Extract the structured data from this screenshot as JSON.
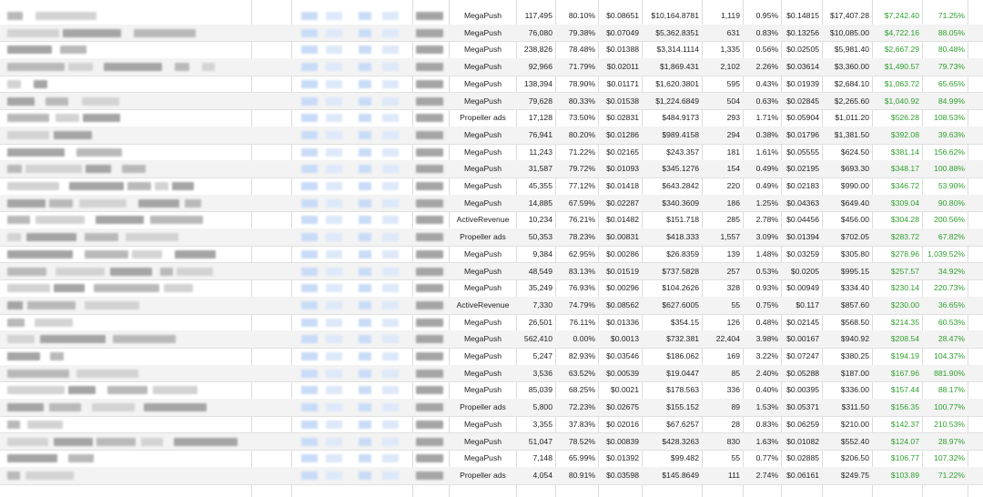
{
  "table": {
    "rows": [
      {
        "network": "MegaPush",
        "v1": "117,495",
        "p1": "80.10%",
        "cost": "$0.08651",
        "total": "$10,164.8781",
        "count": "1,119",
        "p2": "0.95%",
        "rate": "$0.14815",
        "rev": "$17,407.28",
        "profit": "$7,242.40",
        "roi": "71.25%"
      },
      {
        "network": "MegaPush",
        "v1": "76,080",
        "p1": "79.38%",
        "cost": "$0.07049",
        "total": "$5,362.8351",
        "count": "631",
        "p2": "0.83%",
        "rate": "$0.13256",
        "rev": "$10,085.00",
        "profit": "$4,722.16",
        "roi": "88.05%"
      },
      {
        "network": "MegaPush",
        "v1": "238,826",
        "p1": "78.48%",
        "cost": "$0.01388",
        "total": "$3,314.1114",
        "count": "1,335",
        "p2": "0.56%",
        "rate": "$0.02505",
        "rev": "$5,981.40",
        "profit": "$2,667.29",
        "roi": "80.48%"
      },
      {
        "network": "MegaPush",
        "v1": "92,966",
        "p1": "71.79%",
        "cost": "$0.02011",
        "total": "$1,869.431",
        "count": "2,102",
        "p2": "2.26%",
        "rate": "$0.03614",
        "rev": "$3,360.00",
        "profit": "$1,490.57",
        "roi": "79.73%"
      },
      {
        "network": "MegaPush",
        "v1": "138,394",
        "p1": "78.90%",
        "cost": "$0.01171",
        "total": "$1,620.3801",
        "count": "595",
        "p2": "0.43%",
        "rate": "$0.01939",
        "rev": "$2,684.10",
        "profit": "$1,063.72",
        "roi": "65.65%"
      },
      {
        "network": "MegaPush",
        "v1": "79,628",
        "p1": "80.33%",
        "cost": "$0.01538",
        "total": "$1,224.6849",
        "count": "504",
        "p2": "0.63%",
        "rate": "$0.02845",
        "rev": "$2,265.60",
        "profit": "$1,040.92",
        "roi": "84.99%"
      },
      {
        "network": "Propeller ads",
        "v1": "17,128",
        "p1": "73.50%",
        "cost": "$0.02831",
        "total": "$484.9173",
        "count": "293",
        "p2": "1.71%",
        "rate": "$0.05904",
        "rev": "$1,011.20",
        "profit": "$526.28",
        "roi": "108.53%"
      },
      {
        "network": "MegaPush",
        "v1": "76,941",
        "p1": "80.20%",
        "cost": "$0.01286",
        "total": "$989.4158",
        "count": "294",
        "p2": "0.38%",
        "rate": "$0.01796",
        "rev": "$1,381.50",
        "profit": "$392.08",
        "roi": "39.63%"
      },
      {
        "network": "MegaPush",
        "v1": "11,243",
        "p1": "71.22%",
        "cost": "$0.02165",
        "total": "$243.357",
        "count": "181",
        "p2": "1.61%",
        "rate": "$0.05555",
        "rev": "$624.50",
        "profit": "$381.14",
        "roi": "156.62%"
      },
      {
        "network": "MegaPush",
        "v1": "31,587",
        "p1": "79.72%",
        "cost": "$0.01093",
        "total": "$345.1276",
        "count": "154",
        "p2": "0.49%",
        "rate": "$0.02195",
        "rev": "$693.30",
        "profit": "$348.17",
        "roi": "100.88%"
      },
      {
        "network": "MegaPush",
        "v1": "45,355",
        "p1": "77.12%",
        "cost": "$0.01418",
        "total": "$643.2842",
        "count": "220",
        "p2": "0.49%",
        "rate": "$0.02183",
        "rev": "$990.00",
        "profit": "$346.72",
        "roi": "53.90%"
      },
      {
        "network": "MegaPush",
        "v1": "14,885",
        "p1": "67.59%",
        "cost": "$0.02287",
        "total": "$340.3609",
        "count": "186",
        "p2": "1.25%",
        "rate": "$0.04363",
        "rev": "$649.40",
        "profit": "$309.04",
        "roi": "90.80%"
      },
      {
        "network": "ActiveRevenue",
        "v1": "10,234",
        "p1": "76.21%",
        "cost": "$0.01482",
        "total": "$151.718",
        "count": "285",
        "p2": "2.78%",
        "rate": "$0.04456",
        "rev": "$456.00",
        "profit": "$304.28",
        "roi": "200.56%"
      },
      {
        "network": "Propeller ads",
        "v1": "50,353",
        "p1": "78.23%",
        "cost": "$0.00831",
        "total": "$418.333",
        "count": "1,557",
        "p2": "3.09%",
        "rate": "$0.01394",
        "rev": "$702.05",
        "profit": "$283.72",
        "roi": "67.82%"
      },
      {
        "network": "MegaPush",
        "v1": "9,384",
        "p1": "62.95%",
        "cost": "$0.00286",
        "total": "$26.8359",
        "count": "139",
        "p2": "1.48%",
        "rate": "$0.03259",
        "rev": "$305.80",
        "profit": "$278.96",
        "roi": "1,039.52%"
      },
      {
        "network": "MegaPush",
        "v1": "48,549",
        "p1": "83.13%",
        "cost": "$0.01519",
        "total": "$737.5828",
        "count": "257",
        "p2": "0.53%",
        "rate": "$0.0205",
        "rev": "$995.15",
        "profit": "$257.57",
        "roi": "34.92%"
      },
      {
        "network": "MegaPush",
        "v1": "35,249",
        "p1": "76.93%",
        "cost": "$0.00296",
        "total": "$104.2626",
        "count": "328",
        "p2": "0.93%",
        "rate": "$0.00949",
        "rev": "$334.40",
        "profit": "$230.14",
        "roi": "220.73%"
      },
      {
        "network": "ActiveRevenue",
        "v1": "7,330",
        "p1": "74.79%",
        "cost": "$0.08562",
        "total": "$627.6005",
        "count": "55",
        "p2": "0.75%",
        "rate": "$0.117",
        "rev": "$857.60",
        "profit": "$230.00",
        "roi": "36.65%"
      },
      {
        "network": "MegaPush",
        "v1": "26,501",
        "p1": "76.11%",
        "cost": "$0.01336",
        "total": "$354.15",
        "count": "126",
        "p2": "0.48%",
        "rate": "$0.02145",
        "rev": "$568.50",
        "profit": "$214.35",
        "roi": "60.53%"
      },
      {
        "network": "MegaPush",
        "v1": "562,410",
        "p1": "0.00%",
        "cost": "$0.0013",
        "total": "$732.381",
        "count": "22,404",
        "p2": "3.98%",
        "rate": "$0.00167",
        "rev": "$940.92",
        "profit": "$208.54",
        "roi": "28.47%"
      },
      {
        "network": "MegaPush",
        "v1": "5,247",
        "p1": "82.93%",
        "cost": "$0.03546",
        "total": "$186.062",
        "count": "169",
        "p2": "3.22%",
        "rate": "$0.07247",
        "rev": "$380.25",
        "profit": "$194.19",
        "roi": "104.37%"
      },
      {
        "network": "MegaPush",
        "v1": "3,536",
        "p1": "63.52%",
        "cost": "$0.00539",
        "total": "$19.0447",
        "count": "85",
        "p2": "2.40%",
        "rate": "$0.05288",
        "rev": "$187.00",
        "profit": "$167.96",
        "roi": "881.90%"
      },
      {
        "network": "MegaPush",
        "v1": "85,039",
        "p1": "68.25%",
        "cost": "$0.0021",
        "total": "$178.563",
        "count": "336",
        "p2": "0.40%",
        "rate": "$0.00395",
        "rev": "$336.00",
        "profit": "$157.44",
        "roi": "88.17%"
      },
      {
        "network": "Propeller ads",
        "v1": "5,800",
        "p1": "72.23%",
        "cost": "$0.02675",
        "total": "$155.152",
        "count": "89",
        "p2": "1.53%",
        "rate": "$0.05371",
        "rev": "$311.50",
        "profit": "$156.35",
        "roi": "100.77%"
      },
      {
        "network": "MegaPush",
        "v1": "3,355",
        "p1": "37.83%",
        "cost": "$0.02016",
        "total": "$67.6257",
        "count": "28",
        "p2": "0.83%",
        "rate": "$0.06259",
        "rev": "$210.00",
        "profit": "$142.37",
        "roi": "210.53%"
      },
      {
        "network": "MegaPush",
        "v1": "51,047",
        "p1": "78.52%",
        "cost": "$0.00839",
        "total": "$428.3263",
        "count": "830",
        "p2": "1.63%",
        "rate": "$0.01082",
        "rev": "$552.40",
        "profit": "$124.07",
        "roi": "28.97%"
      },
      {
        "network": "MegaPush",
        "v1": "7,148",
        "p1": "65.99%",
        "cost": "$0.01392",
        "total": "$99.482",
        "count": "55",
        "p2": "0.77%",
        "rate": "$0.02885",
        "rev": "$206.50",
        "profit": "$106.77",
        "roi": "107.32%"
      },
      {
        "network": "Propeller ads",
        "v1": "4,054",
        "p1": "80.91%",
        "cost": "$0.03598",
        "total": "$145.8649",
        "count": "111",
        "p2": "2.74%",
        "rate": "$0.06161",
        "rev": "$249.75",
        "profit": "$103.89",
        "roi": "71.22%"
      }
    ]
  }
}
